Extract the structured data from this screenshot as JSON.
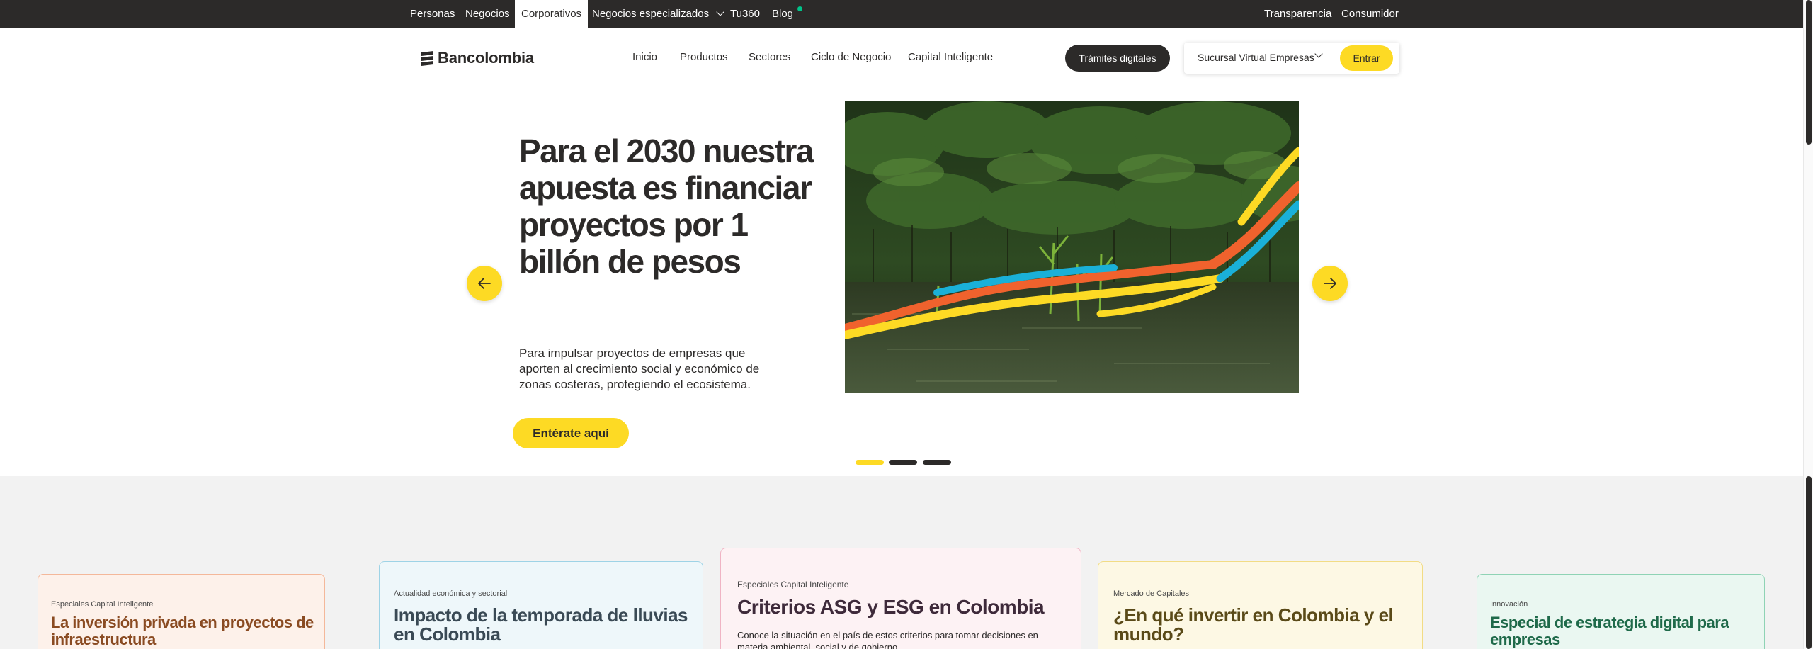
{
  "topbar": {
    "segments": [
      "Personas",
      "Negocios",
      "Corporativos",
      "Negocios especializados",
      "Tu360",
      "Blog"
    ],
    "right_links": [
      "Transparencia",
      "Consumidor"
    ]
  },
  "header": {
    "logo_text": "Bancolombia",
    "nav": [
      "Inicio",
      "Productos",
      "Sectores",
      "Ciclo de Negocio",
      "Capital Inteligente"
    ],
    "tramites_label": "Trámites digitales",
    "sucursal_label": "Sucursal Virtual Empresas",
    "entrar_label": "Entrar"
  },
  "hero": {
    "title": "Para el 2030 nuestra apuesta es financiar proyectos por 1 billón de pesos",
    "description": "Para impulsar proyectos de empresas que aporten al crecimiento social y económico de zonas costeras, protegiendo el ecosistema.",
    "cta_label": "Entérate aquí",
    "slides_total": 3,
    "active_slide": 1
  },
  "cards": [
    {
      "category": "Especiales Capital Inteligente",
      "title": "La inversión privada en proyectos de infraestructura",
      "description": ""
    },
    {
      "category": "Actualidad económica y sectorial",
      "title": "Impacto de la temporada de lluvias en Colombia",
      "description": ""
    },
    {
      "category": "Especiales Capital Inteligente",
      "title": "Criterios ASG y ESG en Colombia",
      "description": "Conoce la situación en el país de estos criterios para tomar decisiones en materia ambiental, social y de gobierno"
    },
    {
      "category": "Mercado de Capitales",
      "title": "¿En qué invertir en Colombia y el mundo?",
      "description": ""
    },
    {
      "category": "Innovación",
      "title": "Especial de estrategia digital para empresas",
      "description": ""
    }
  ],
  "colors": {
    "brand_yellow": "#fdda24",
    "dark": "#2c2a29",
    "status_green": "#00c389"
  },
  "icons": [
    "bancolombia-logo-icon",
    "chevron-down-icon",
    "arrow-left-icon",
    "arrow-right-icon"
  ]
}
